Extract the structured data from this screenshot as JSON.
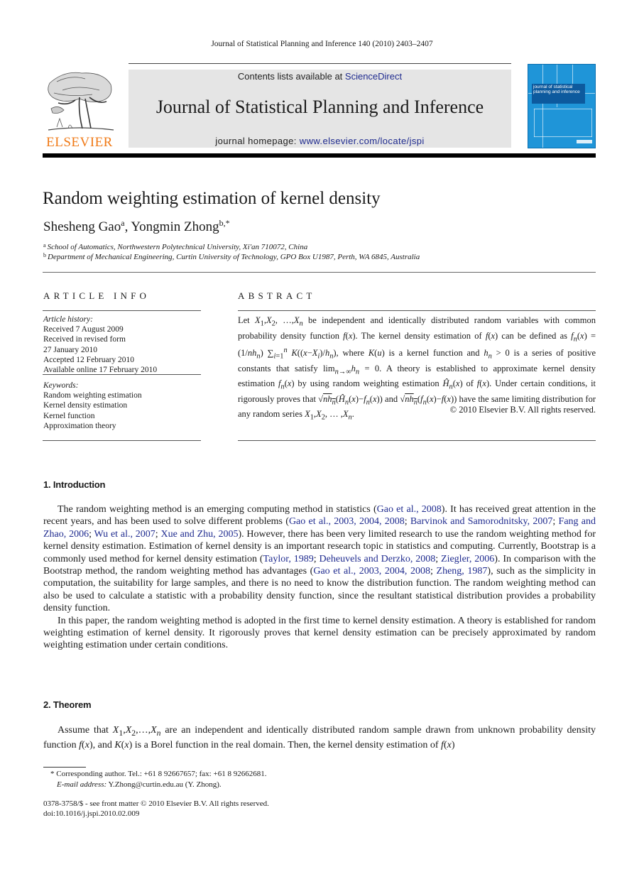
{
  "running_head": "Journal of Statistical Planning and Inference 140 (2010) 2403–2407",
  "publisher": {
    "wordmark": "ELSEVIER",
    "logo_icon": "elsevier-tree-icon",
    "wordmark_color": "#f07a17"
  },
  "banner": {
    "contents_prefix": "Contents lists available at ",
    "contents_link": "ScienceDirect",
    "journal_name": "Journal of Statistical Planning and Inference",
    "homepage_prefix": "journal homepage: ",
    "homepage_link": "www.elsevier.com/locate/jspi",
    "background": "#e5e5e5",
    "link_color": "#1f2b8f"
  },
  "cover": {
    "title": "journal of statistical planning and inference",
    "color": "#1f95d8"
  },
  "article": {
    "title": "Random weighting estimation of kernel density",
    "authors": [
      {
        "name": "Shesheng Gao",
        "marks": "a"
      },
      {
        "name": "Yongmin Zhong",
        "marks": "b,*"
      }
    ],
    "affiliations": [
      {
        "mark": "a",
        "text": "School of Automatics, Northwestern Polytechnical University, Xi'an 710072, China"
      },
      {
        "mark": "b",
        "text": "Department of Mechanical Engineering, Curtin University of Technology, GPO Box U1987, Perth, WA 6845, Australia"
      }
    ]
  },
  "article_info": {
    "heading": "ARTICLE INFO",
    "history_label": "Article history:",
    "history": [
      "Received 7 August 2009",
      "Received in revised form",
      "27 January 2010",
      "Accepted 12 February 2010",
      "Available online 17 February 2010"
    ],
    "keywords_label": "Keywords:",
    "keywords": [
      "Random weighting estimation",
      "Kernel density estimation",
      "Kernel function",
      "Approximation theory"
    ]
  },
  "abstract": {
    "heading": "ABSTRACT",
    "copyright": "© 2010 Elsevier B.V. All rights reserved."
  },
  "sections": [
    {
      "heading": "1.  Introduction",
      "citations": [
        "Gao et al., 2008",
        "Gao et al., 2003, 2004, 2008",
        "Barvinok and Samorodnitsky, 2007",
        "Fang and Zhao, 2006",
        "Wu et al., 2007",
        "Xue and Zhu, 2005",
        "Taylor, 1989",
        "Deheuvels and Derzko, 2008",
        "Ziegler, 2006",
        "Gao et al., 2003, 2004, 2008",
        "Zheng, 1987"
      ],
      "text": {
        "p1_a": "The random weighting method is an emerging computing method in statistics (",
        "p1_b": "). It has received great attention in the recent years, and has been used to solve different problems (",
        "p1_c": "). However, there has been very limited research to use the random weighting method for kernel density estimation. Estimation of kernel density is an important research topic in statistics and computing. Currently, Bootstrap is a commonly used method for kernel density estimation (",
        "p1_d": "). In comparison with the Bootstrap method, the random weighting method has advantages (",
        "p1_e": "), such as the simplicity in computation, the suitability for large samples, and there is no need to know the distribution function. The random weighting method can also be used to calculate a statistic with a probability density function, since the resultant statistical distribution provides a probability density function.",
        "p2": "In this paper, the random weighting method is adopted in the first time to kernel density estimation. A theory is established for random weighting estimation of kernel density. It rigorously proves that kernel density estimation can be precisely approximated by random weighting estimation under certain conditions."
      }
    },
    {
      "heading": "2.  Theorem",
      "text": {
        "p1_a": "Assume that ",
        "p1_b": " are an independent and identically distributed random sample drawn from unknown probability density function ",
        "p1_c": ", and ",
        "p1_d": " is a Borel function in the real domain. Then, the kernel density estimation of "
      }
    }
  ],
  "footnotes": {
    "corresponding": "* Corresponding author. Tel.: +61 8 92667657; fax: +61 8 92662681.",
    "email_label": "E-mail address:",
    "email_value": " Y.Zhong@curtin.edu.au (Y. Zhong).",
    "front_matter": "0378-3758/$ - see front matter © 2010 Elsevier B.V. All rights reserved.",
    "doi": "doi:10.1016/j.jspi.2010.02.009"
  }
}
